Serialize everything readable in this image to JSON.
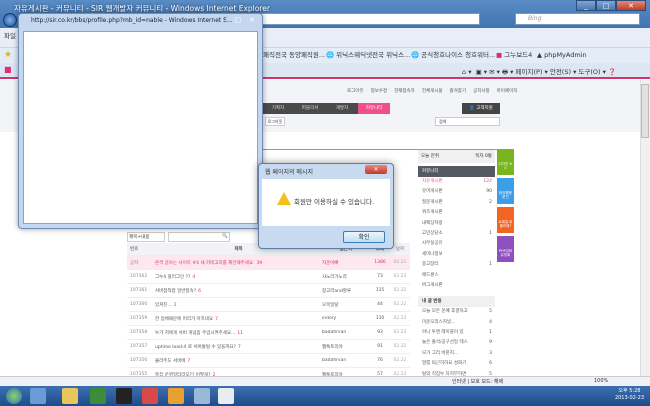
{
  "browser": {
    "title": "자유게시판 - 커뮤니티 - SIR 웹개발자 커뮤니티 - Windows Internet Explorer",
    "search_placeholder": "Bing",
    "menu_file": "파일",
    "favorites": [
      "패직전국 동양패직원...",
      "위닉스웨딕넷전국 위닉스...",
      "공식청호나이스 청호워터...",
      "그누보드4",
      "phpMyAdmin"
    ],
    "tools": [
      "페이지(P) ▾",
      "안전(S) ▾",
      "도구(O) ▾"
    ]
  },
  "popup": {
    "title": "http://sir.co.kr/bbs/profile.php?mb_id=nable - Windows Internet E..."
  },
  "dialog": {
    "title": "웹 페이지의 메시지",
    "message": "회원만 이용하실 수 있습니다.",
    "ok": "확인"
  },
  "header": {
    "top_links": [
      "로그아웃",
      "정보수정",
      "현재접속자",
      "전체게시물",
      "즐겨찾기",
      "공지사항",
      "마이페이지"
    ],
    "gnb": [
      "기획자",
      "퍼블리셔",
      "개발자",
      "커뮤니티"
    ],
    "support": "고객지원",
    "logout": "로그아웃",
    "search_placeholder": "검색"
  },
  "board": {
    "filter": "제목+내용",
    "columns": [
      "번호",
      "제목",
      "글쓴이",
      "조회",
      "날짜"
    ],
    "rows": [
      {
        "no": "공지",
        "subject": "본격 글쓰는 사이트 #4  새 카테고리를 제안해주세요.",
        "comments": "39",
        "name": "지운아빠",
        "hits": "1386",
        "date": "02.21"
      },
      {
        "no": "107362",
        "subject": "그누4 플러그인 ??",
        "comments": "4",
        "name": "사노라가노라",
        "hits": "73",
        "date": "02.22"
      },
      {
        "no": "107361",
        "subject": "서버접착컴 일반접속?",
        "comments": "6",
        "name": "창고러and할루",
        "hits": "115",
        "date": "02.22"
      },
      {
        "no": "107360",
        "subject": "있쳐진...",
        "comments": "2",
        "name": "오목일탈",
        "hits": "44",
        "date": "02.22"
      },
      {
        "no": "107359",
        "subject": "한 업체때문에 머리가 아프네요",
        "comments": "7",
        "name": "indory",
        "hits": "110",
        "date": "02.22"
      },
      {
        "no": "107358",
        "subject": "누가 저에게 서버 개념좀 주입시켜주세요...",
        "comments": "11",
        "name": "badafirvan",
        "hits": "93",
        "date": "02.22"
      },
      {
        "no": "107357",
        "subject": "uptime load-4 로 서버통털 수 있을까요?",
        "comments": "7",
        "name": "웹툭토리야",
        "hits": "91",
        "date": "02.22"
      },
      {
        "no": "107356",
        "subject": "몰라주도 서버에",
        "comments": "7",
        "name": "badafirvan",
        "hits": "76",
        "date": "02.22"
      },
      {
        "no": "107355",
        "subject": "특집 운영일터라모?? 어떻게?",
        "comments": "2",
        "name": "웹툭토리야",
        "hits": "57",
        "date": "02.22"
      }
    ]
  },
  "sidebar": {
    "tab_rank": "오늘 만취",
    "tab_count": "독자 0통",
    "community_title": "커뮤니티",
    "community": [
      {
        "label": "자유게시판",
        "count": "124"
      },
      {
        "label": "유머게시판",
        "count": "90"
      },
      {
        "label": "질문게시판",
        "count": "2"
      },
      {
        "label": "퀴즈게시판",
        "count": ""
      },
      {
        "label": "내팩상자랑",
        "count": ""
      },
      {
        "label": "고민상담소",
        "count": "1"
      },
      {
        "label": "사무실공유",
        "count": ""
      },
      {
        "label": "세미나정보",
        "count": ""
      },
      {
        "label": "중고장터",
        "count": "1"
      },
      {
        "label": "애드센스",
        "count": ""
      },
      {
        "label": "버그게시판",
        "count": ""
      }
    ],
    "reactions_title": "내 글 반응",
    "reactions": [
      {
        "label": "오늘 모든 문예 후결하고",
        "count": "5"
      },
      {
        "label": "미운오리스커널...",
        "count": "4"
      },
      {
        "label": "아니 투명 레이블이 있",
        "count": "1"
      },
      {
        "label": "놀은 출석/공구선일 테스",
        "count": "9"
      },
      {
        "label": "모가 그리 바뀐지...",
        "count": "3"
      },
      {
        "label": "말릅 퇴근하하요 성화기",
        "count": "6"
      },
      {
        "label": "탈의 히집누 차지무하면",
        "count": "5"
      }
    ]
  },
  "quick": [
    {
      "label": "디자인 소스",
      "color": "#7ab51d"
    },
    {
      "label": "현장활용 문진",
      "color": "#3a9ee8"
    },
    {
      "label": "트레일 화롤리에?",
      "color": "#f26522"
    },
    {
      "label": "PHP강좌 유망회",
      "color": "#8e4fbf"
    }
  ],
  "status": {
    "zone": "인터넷 | 보호 모드: 해제",
    "zoom": "100%"
  },
  "clock": {
    "time": "오후 5:28",
    "date": "2013-02-23"
  }
}
